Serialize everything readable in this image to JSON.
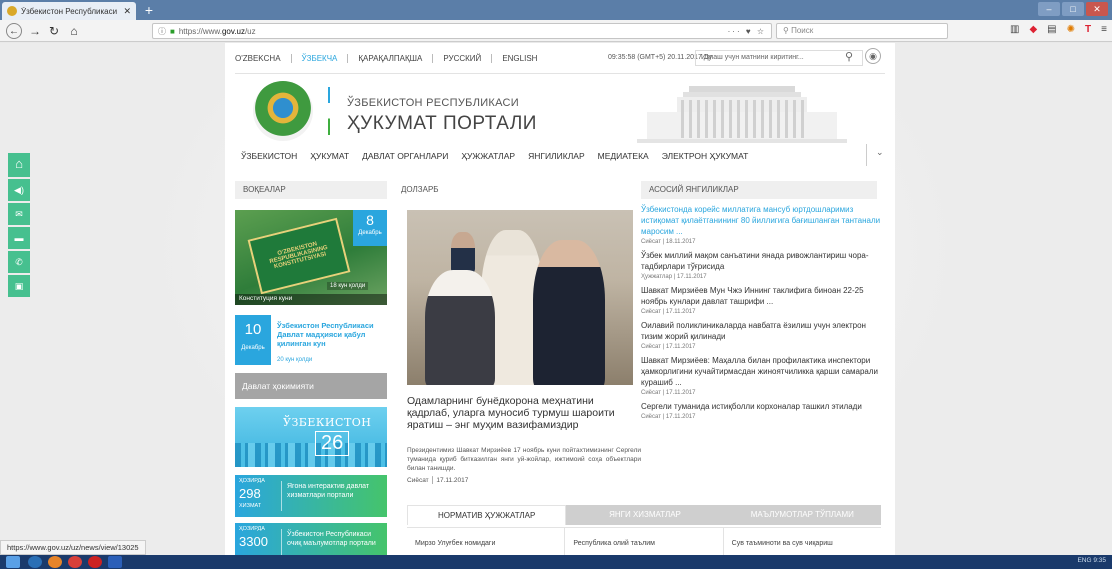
{
  "browser": {
    "tab_title": "Ўзбекистон Республикаси Ҳу",
    "url_prefix": "https://www.",
    "url_host": "gov.uz",
    "url_path": "/uz",
    "url_actions": "··· ♥ ☆",
    "search_placeholder": "Поиск"
  },
  "header": {
    "languages": [
      "O'ZBEKCHA",
      "ЎЗБЕКЧА",
      "ҚАРАҚАЛПАҚША",
      "РУССКИЙ",
      "ENGLISH"
    ],
    "clock": "09:35:58 (GMT+5)  20.11.2017 Ду",
    "search_placeholder": "Излаш учун матнини киритинг..."
  },
  "brand": {
    "republic": "ЎЗБЕКИСТОН РЕСПУБЛИКАСИ",
    "portal": "ҲУКУМАТ ПОРТАЛИ"
  },
  "nav": [
    "ЎЗБЕКИСТОН",
    "ҲУКУМАТ",
    "ДАВЛАТ ОРГАНЛАРИ",
    "ҲУЖЖАТЛАР",
    "ЯНГИЛИКЛАР",
    "МЕДИАТЕКА",
    "ЭЛЕКТРОН ҲУКУМАТ"
  ],
  "sections": {
    "events": "ВОҚЕАЛАР",
    "topical": "ДОЛЗАРБ",
    "main_news": "АСОСИЙ ЯНГИЛИКЛАР"
  },
  "constitution": {
    "day": "8",
    "month": "Декабрь",
    "days_left": "18 кун қолди",
    "caption": "Конституция куни",
    "book_text": "O'ZBEKISTON RESPUBLIKASINING KONSTITUTSIYASI"
  },
  "event": {
    "day": "10",
    "month": "Декабрь",
    "title": "Ўзбекистон Республикаси Давлат мадҳияси қабул қилинган кун",
    "days_left": "20 кун қолди"
  },
  "gov": {
    "heading": "Давлат ҳокимияти",
    "uzb_title": "ЎЗБЕКИСТОН",
    "uzb_num": "26"
  },
  "stats": [
    {
      "label": "ҲОЗИРДА",
      "number": "298",
      "sub": "ХИЗМАТ",
      "text": "Ягона интерактив давлат хизматлари портали"
    },
    {
      "label": "ҲОЗИРДА",
      "number": "3300",
      "sub": "",
      "text": "Ўзбекистон Республикаси очиқ маълумотлар портали"
    }
  ],
  "topical": {
    "title": "Одамларнинг бунёдкорона меҳнатини қадрлаб, уларга муносиб турмуш шароити яратиш – энг муҳим вазифамиздир",
    "body": "Президентимиз Шавкат Мирзиёев 17 ноябрь куни пойтахтимизнинг Сергели туманида қуриб битказилган янги уй-жойлар, ижтимоий соҳа объектлари билан танишди.",
    "category": "Сиёсат",
    "date": "17.11.2017"
  },
  "news": [
    {
      "title": "Ўзбекистонда корейс миллатига мансуб юртдошларимиз истиқомат қилаётганининг 80 йиллигига бағишланган тантанали маросим ...",
      "category": "Сиёсат",
      "date": "18.11.2017"
    },
    {
      "title": "Ўзбек миллий мақом санъатини янада ривожлантириш чора-тадбирлари тўғрисида",
      "category": "Ҳужжатлар",
      "date": "17.11.2017"
    },
    {
      "title": "Шавкат Мирзиёев Мун Чжэ Иннинг таклифига биноан 22-25 ноябрь кунлари давлат ташрифи ...",
      "category": "Сиёсат",
      "date": "17.11.2017"
    },
    {
      "title": "Оилавий поликлиникаларда навбатга ёзилиш учун электрон тизим жорий қилинади",
      "category": "Сиёсат",
      "date": "17.11.2017"
    },
    {
      "title": "Шавкат Мирзиёев: Маҳалла билан профилактика инспектори ҳамкорлигини кучайтирмасдан жиноятчиликка қарши самарали курашиб ...",
      "category": "Сиёсат",
      "date": "17.11.2017"
    },
    {
      "title": "Сергели туманида истиқболли корхоналар ташкил этилади",
      "category": "Сиёсат",
      "date": "17.11.2017"
    }
  ],
  "tabs": [
    "НОРМАТИВ ҲУЖЖАТЛАР",
    "ЯНГИ ХИЗМАТЛАР",
    "МАЪЛУМОТЛАР ТЎПЛАМИ"
  ],
  "docs": [
    "Мирзо Улуғбек номидаги",
    "Республика олий таълим",
    "Сув таъминоти ва сув чиқариш"
  ],
  "status_url": "https://www.gov.uz/uz/news/view/13025",
  "tray": "ENG  9:35"
}
